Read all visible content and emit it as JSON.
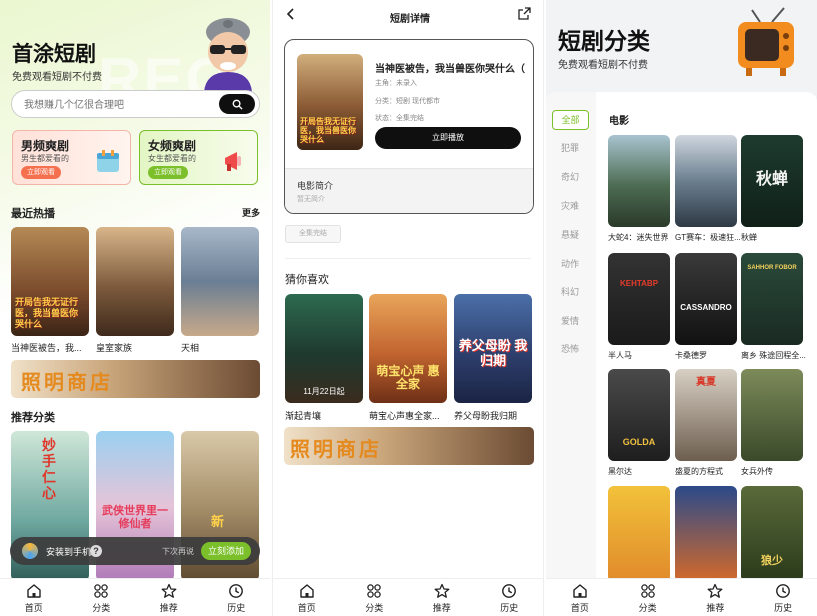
{
  "home": {
    "title": "首涂短剧",
    "subtitle": "免费观看短剧不付费",
    "search_placeholder": "我想赚几个亿很合理吧",
    "male_card": {
      "title": "男频爽剧",
      "sub": "男生都爱看的",
      "btn": "立即观看"
    },
    "female_card": {
      "title": "女频爽剧",
      "sub": "女生都爱看的",
      "btn": "立即观看"
    },
    "hot_section": "最近热播",
    "more": "更多",
    "hot_items": [
      "当神医被告，我...",
      "皇室家族",
      "天相"
    ],
    "banner_text": "照明商店",
    "recommend_section": "推荐分类",
    "rec_poster_texts": [
      "妙手仁心",
      "武侠世界里一修仙者",
      "新"
    ],
    "install_bar": {
      "text": "安装到手机",
      "later": "下次再说",
      "btn": "立刻添加"
    }
  },
  "detail": {
    "header_title": "短剧详情",
    "drama_title": "当神医被告，我当兽医你哭什么（全",
    "poster_text": "开局告我无证行医，我当兽医你哭什么",
    "lead_label": "主角：",
    "lead_value": "未录入",
    "category_label": "分类：",
    "category_value": "短剧 现代都市",
    "status_label": "状态：",
    "status_value": "全集完结",
    "play_btn": "立即播放",
    "intro_title": "电影简介",
    "intro_text": "暂无简介",
    "episodes_btn": "全集完结",
    "guess_section": "猜你喜欢",
    "guess_items": [
      "渐起青壤",
      "萌宝心声惠全家...",
      "养父母盼我归期"
    ],
    "guess_poster_texts": [
      "11月22日起",
      "萌宝心声 惠全家",
      "养父母盼 我归期"
    ],
    "banner_text": "照明商店"
  },
  "category": {
    "title": "短剧分类",
    "subtitle": "免费观看短剧不付费",
    "sidebar": [
      "全部",
      "犯罪",
      "奇幻",
      "灾难",
      "悬疑",
      "动作",
      "科幻",
      "爱情",
      "恐怖"
    ],
    "section": "电影",
    "items": [
      "大蛇4：迷失世界",
      "GT赛车：极速狂...",
      "秋蝉",
      "半人马",
      "卡桑德罗",
      "离乡 殊途回程全...",
      "黑尔达",
      "盛夏的方程式",
      "女兵外传",
      "",
      "",
      ""
    ],
    "poster_texts": [
      "",
      "",
      "秋蝉",
      "KEHTABP",
      "CASSANDRO",
      "SAHHOR FOBOR",
      "GOLDA",
      "真夏",
      "",
      "",
      "",
      "狼少"
    ]
  },
  "tabbar": [
    {
      "label": "首页",
      "icon": "home-icon"
    },
    {
      "label": "分类",
      "icon": "category-icon"
    },
    {
      "label": "推荐",
      "icon": "star-icon"
    },
    {
      "label": "历史",
      "icon": "clock-icon"
    }
  ],
  "colors": {
    "accent_green": "#7bbf2a",
    "dark_button": "#0f0f0f",
    "banner_orange": "#e58a1f"
  }
}
